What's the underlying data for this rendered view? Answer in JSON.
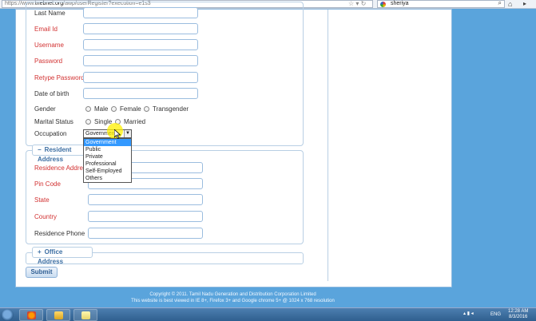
{
  "browser": {
    "url_prefix": "https://www.",
    "url_domain": "tnebnet.org",
    "url_path": "/awp/userRegister?execution=e1s3",
    "search_value": "sheriya"
  },
  "form": {
    "fields": {
      "last_name": "Last Name",
      "email": "Email Id",
      "username": "Username",
      "password": "Password",
      "retype_password": "Retype Password",
      "dob": "Date of birth"
    },
    "gender": {
      "label": "Gender",
      "options": [
        "Male",
        "Female",
        "Transgender"
      ]
    },
    "marital": {
      "label": "Marital Status",
      "options": [
        "Single",
        "Married"
      ]
    },
    "occupation": {
      "label": "Occupation",
      "selected": "Government",
      "options": [
        "Government",
        "Public",
        "Private",
        "Professional",
        "Self-Employed",
        "Others"
      ]
    },
    "residence": {
      "legend": "Resident Address",
      "fields": {
        "address": "Residence Address",
        "pincode": "Pin Code",
        "state": "State",
        "country": "Country",
        "phone": "Residence Phone"
      }
    },
    "office": {
      "legend": "Office Address"
    },
    "submit_label": "Submit"
  },
  "footer": {
    "line1": "Copyright © 2011. Tamil Nadu Generation and Distribution Corporation Limited",
    "line2": "This website is best viewed in IE 8+, Firefox 3+ and Google chrome 5+ @ 1024 x 768 resolution"
  },
  "taskbar": {
    "lang": "ENG",
    "time": "12:28 AM",
    "date": "8/3/2016"
  },
  "icons": {
    "legend_collapse": "minus",
    "legend_expand": "plus"
  }
}
